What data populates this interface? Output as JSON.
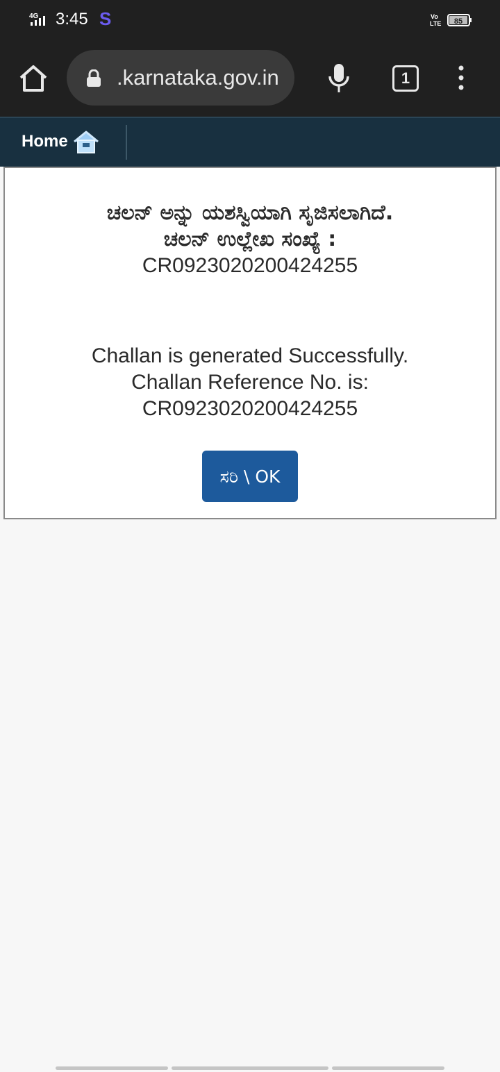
{
  "status_bar": {
    "network": "4G",
    "time": "3:45",
    "app_indicator": "S",
    "volte": "Vo LTE",
    "battery": "85"
  },
  "browser": {
    "url": ".karnataka.gov.in",
    "tab_count": "1",
    "icons": [
      "home-icon",
      "lock-icon",
      "mic-icon",
      "tab-switcher-icon",
      "more-vert-icon"
    ]
  },
  "site_nav": {
    "home_label": "Home",
    "home_icon": "house-icon"
  },
  "dialog": {
    "kannada_lines": [
      "ಚಲನ್ ಅನ್ನು ಯಶಸ್ವಿಯಾಗಿ ಸೃಜಿಸಲಾಗಿದೆ.",
      "ಚಲನ್ ಉಲ್ಲೇಖ ಸಂಖ್ಯೆ :",
      "CR0923020200424255"
    ],
    "english_lines": [
      "Challan is generated Successfully.",
      "Challan Reference No. is:",
      "CR0923020200424255"
    ],
    "ok_button_label": "ಸರಿ \\ OK",
    "button_color": "#1d5a9c"
  }
}
